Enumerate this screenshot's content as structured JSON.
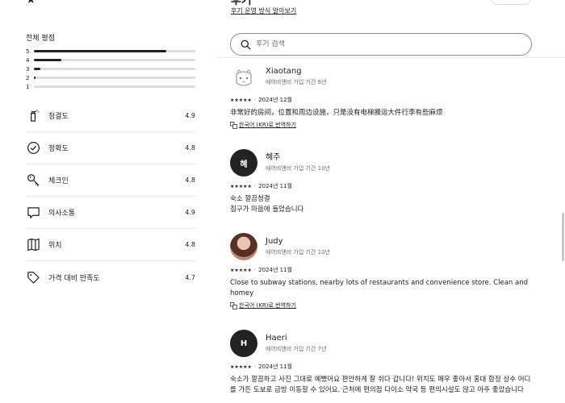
{
  "header": {
    "star_glyph": "★",
    "title": "후기 ",
    "learn_link": "후기 운영 방식 알아보기"
  },
  "search": {
    "placeholder": "후기 검색",
    "icon": "search-icon"
  },
  "overall": {
    "title": "전체 평점",
    "distribution": [
      {
        "label": "5",
        "fraction": 0.82
      },
      {
        "label": "4",
        "fraction": 0.17
      },
      {
        "label": "3",
        "fraction": 0.04
      },
      {
        "label": "2",
        "fraction": 0.01
      },
      {
        "label": "1",
        "fraction": 0.0
      }
    ]
  },
  "categories": [
    {
      "icon": "spray-bottle-icon",
      "label": "청결도",
      "score": "4.9"
    },
    {
      "icon": "check-circle-icon",
      "label": "정확도",
      "score": "4.8"
    },
    {
      "icon": "key-icon",
      "label": "체크인",
      "score": "4.8"
    },
    {
      "icon": "chat-bubble-icon",
      "label": "의사소통",
      "score": "4.9"
    },
    {
      "icon": "map-icon",
      "label": "위치",
      "score": "4.8"
    },
    {
      "icon": "price-tag-icon",
      "label": "가격 대비 만족도",
      "score": "4.7"
    }
  ],
  "reviews": [
    {
      "name": "Xiaotang",
      "tenure": "에어비앤비 가입 기간 6년",
      "avatar_type": "illustration",
      "avatar_initial": "",
      "stars": "★★★★★",
      "date": "2024년 12월",
      "text": "非常好的房间，位置和周边设施，只是没有电梯搬运大件行李有些麻烦",
      "translate": "한국어 (KR)로 번역하기"
    },
    {
      "name": "혜주",
      "tenure": "에어비앤비 가입 기간 10년",
      "avatar_type": "initial",
      "avatar_initial": "혜",
      "stars": "★★★★★",
      "date": "2024년 11월",
      "text": "숙소 깔끔청결\n침구가 마음에 들었습니다",
      "translate": ""
    },
    {
      "name": "Judy",
      "tenure": "에어비앤비 가입 기간 10년",
      "avatar_type": "photo",
      "avatar_initial": "",
      "stars": "★★★★★",
      "date": "2024년 11월",
      "text": "Close to subway stations, nearby lots of restaurants and convenience store. Clean and homey",
      "translate": "한국어 (KR)로 번역하기"
    },
    {
      "name": "Haeri",
      "tenure": "에어비앤비 가입 기간 7년",
      "avatar_type": "initial",
      "avatar_initial": "H",
      "stars": "★★★★★",
      "date": "2024년 11월",
      "text": "숙소가 깔끔하고 사진 그대로 예뻤어요 편안하게 잘 쉬다 갑니다! 위치도 매우 좋아서 홍대 합정 상수 어디를 가든 도보로 금방 이동할 수 있어요. 근처에 편의점 다이소 약국 등 편의시설도 많고 아주 좋았습니다",
      "translate": ""
    }
  ],
  "colors": {
    "text": "#222222",
    "muted": "#6a6a6a",
    "divider": "#ebebeb",
    "bar_track": "#dddddd"
  }
}
